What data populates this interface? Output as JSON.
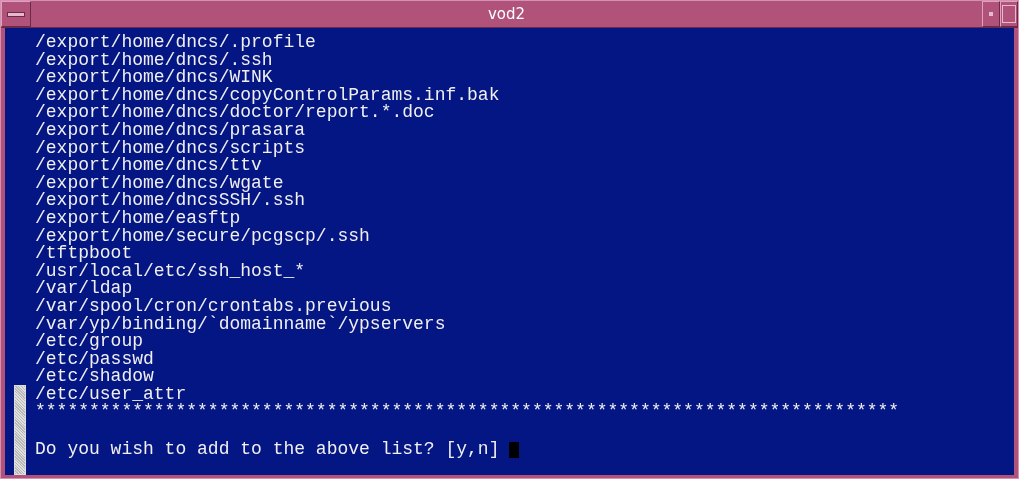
{
  "window": {
    "title": "vod2"
  },
  "terminal": {
    "lines": [
      "/export/home/dncs/.profile",
      "/export/home/dncs/.ssh",
      "/export/home/dncs/WINK",
      "/export/home/dncs/copyControlParams.inf.bak",
      "/export/home/dncs/doctor/report.*.doc",
      "/export/home/dncs/prasara",
      "/export/home/dncs/scripts",
      "/export/home/dncs/ttv",
      "/export/home/dncs/wgate",
      "/export/home/dncsSSH/.ssh",
      "/export/home/easftp",
      "/export/home/secure/pcgscp/.ssh",
      "/tftpboot",
      "/usr/local/etc/ssh_host_*",
      "/var/ldap",
      "/var/spool/cron/crontabs.previous",
      "/var/yp/binding/`domainname`/ypservers",
      "/etc/group",
      "/etc/passwd",
      "/etc/shadow",
      "/etc/user_attr"
    ],
    "separator": "********************************************************************************",
    "prompt": "Do you wish to add to the above list? [y,n]"
  }
}
